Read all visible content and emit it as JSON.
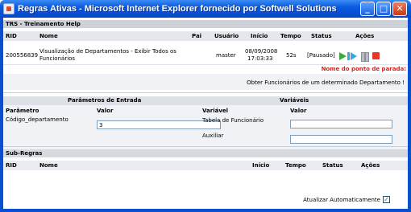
{
  "window": {
    "title": "Regras Ativas - Microsoft Internet Explorer fornecido por Softwell Solutions",
    "min_glyph": "_",
    "max_glyph": "□",
    "close_glyph": "✕"
  },
  "rule_section": {
    "title": "TRS - Treinamento Help",
    "columns": [
      "RID",
      "Nome",
      "Pai",
      "Usuário",
      "Início",
      "Tempo",
      "Status",
      "Ações"
    ],
    "row": {
      "rid": "200556839",
      "name_line1": "Visualização de Departamentos - Exibir Todos os",
      "name_line2": "Funcionários",
      "pai": "",
      "usuario": "master",
      "inicio_date": "08/09/2008",
      "inicio_time": "17:03:33",
      "tempo": "52s",
      "status": "[Pausado]",
      "action_icons": [
        "play-icon",
        "step-icon",
        "pause-icon",
        "stop-icon"
      ]
    },
    "breakpoint_label": "Nome do ponto de parada:",
    "breakpoint_text": "Obter Funcionários de um determinado Departamento !"
  },
  "params": {
    "entrada_title": "Parâmetros de Entrada",
    "variaveis_title": "Variáveis",
    "param_col": "Parâmetro",
    "valor_col": "Valor",
    "var_col": "Variável",
    "var_valor_col": "Valor",
    "param_name": "Código_departamento",
    "param_value": "3",
    "variables": [
      {
        "name": "Tabela de Funcionário",
        "value": ""
      },
      {
        "name": "Auxiliar",
        "value": ""
      }
    ]
  },
  "subrules": {
    "title": "Sub-Regras",
    "columns": [
      "RID",
      "Nome",
      "Início",
      "Tempo",
      "Status",
      "Ações"
    ]
  },
  "footer": {
    "auto_update_label": "Atualizar Automaticamente",
    "auto_update_checked": true,
    "check_glyph": "✓"
  },
  "colors": {
    "titlebar": "#0a5ae0",
    "breakpoint": "#d9231a",
    "play": "#2fb32f",
    "stop": "#e43a24"
  }
}
